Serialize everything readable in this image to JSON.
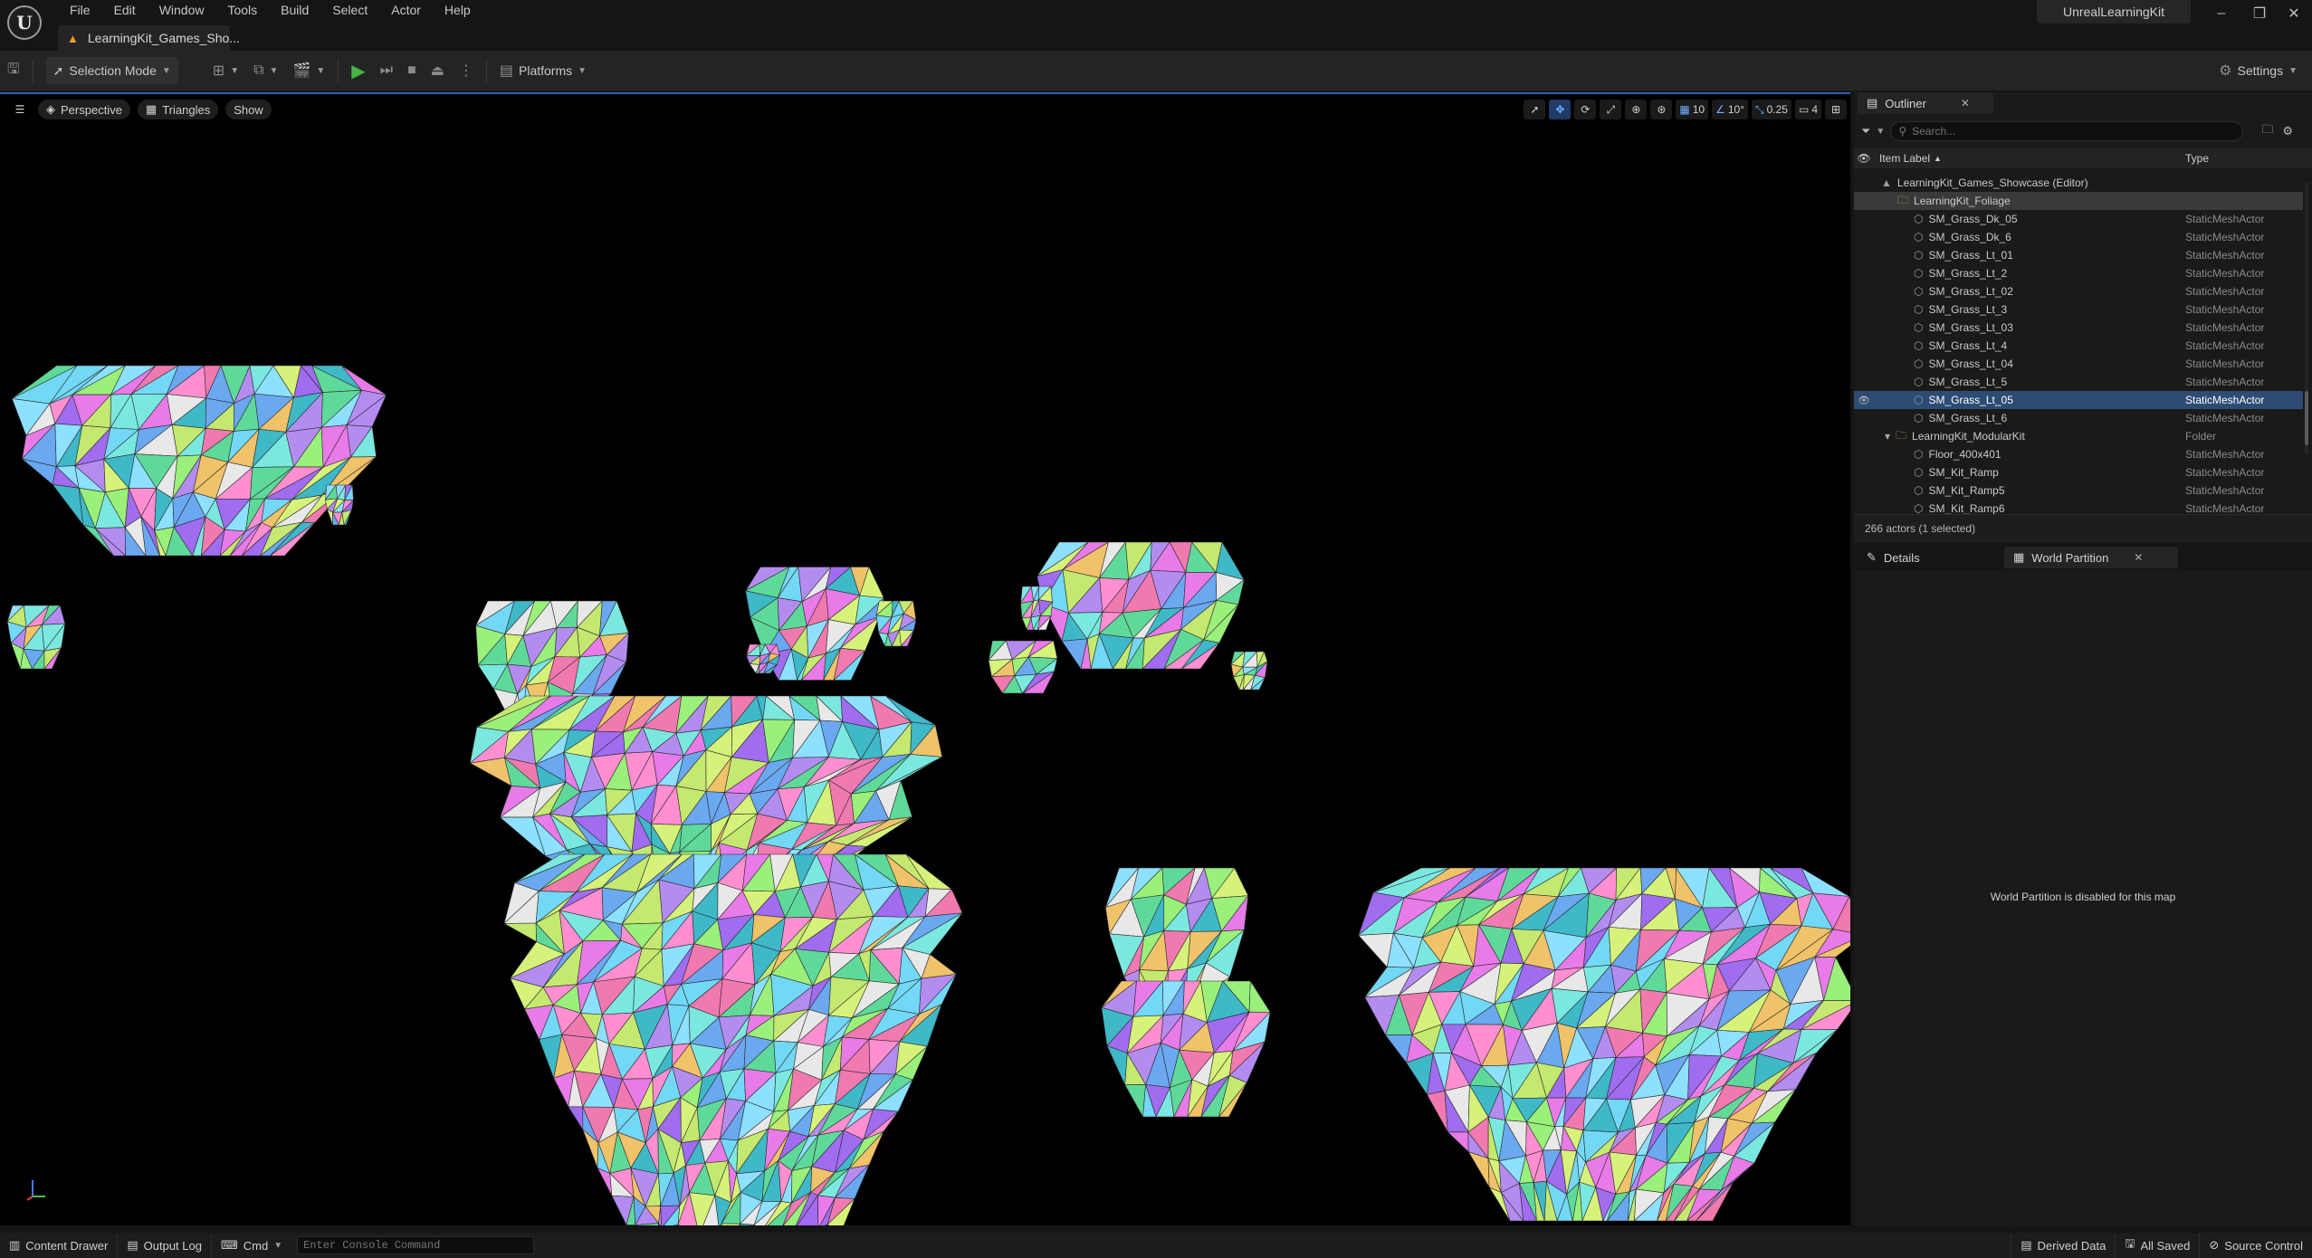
{
  "menu": [
    "File",
    "Edit",
    "Window",
    "Tools",
    "Build",
    "Select",
    "Actor",
    "Help"
  ],
  "project_name": "UnrealLearningKit",
  "document_tab": "LearningKit_Games_Sho...",
  "toolbar": {
    "mode_label": "Selection Mode",
    "platforms_label": "Platforms",
    "settings_label": "Settings"
  },
  "viewport": {
    "perspective_label": "Perspective",
    "view_mode_label": "Triangles",
    "show_label": "Show",
    "grid_snap": "10",
    "rotation_snap": "10°",
    "scale_snap": "0.25",
    "camera_speed": "4"
  },
  "outliner": {
    "tab_label": "Outliner",
    "search_placeholder": "Search...",
    "col_label": "Item Label",
    "col_type": "Type",
    "rows": [
      {
        "label": "LearningKit_Games_Showcase (Editor)",
        "type": "",
        "kind": "world",
        "indent": 0
      },
      {
        "label": "LearningKit_Foliage",
        "type": "",
        "kind": "folder",
        "indent": 1
      },
      {
        "label": "SM_Grass_Dk_05",
        "type": "StaticMeshActor",
        "kind": "mesh",
        "indent": 2
      },
      {
        "label": "SM_Grass_Dk_6",
        "type": "StaticMeshActor",
        "kind": "mesh",
        "indent": 2
      },
      {
        "label": "SM_Grass_Lt_01",
        "type": "StaticMeshActor",
        "kind": "mesh",
        "indent": 2
      },
      {
        "label": "SM_Grass_Lt_2",
        "type": "StaticMeshActor",
        "kind": "mesh",
        "indent": 2
      },
      {
        "label": "SM_Grass_Lt_02",
        "type": "StaticMeshActor",
        "kind": "mesh",
        "indent": 2
      },
      {
        "label": "SM_Grass_Lt_3",
        "type": "StaticMeshActor",
        "kind": "mesh",
        "indent": 2
      },
      {
        "label": "SM_Grass_Lt_03",
        "type": "StaticMeshActor",
        "kind": "mesh",
        "indent": 2
      },
      {
        "label": "SM_Grass_Lt_4",
        "type": "StaticMeshActor",
        "kind": "mesh",
        "indent": 2
      },
      {
        "label": "SM_Grass_Lt_04",
        "type": "StaticMeshActor",
        "kind": "mesh",
        "indent": 2
      },
      {
        "label": "SM_Grass_Lt_5",
        "type": "StaticMeshActor",
        "kind": "mesh",
        "indent": 2
      },
      {
        "label": "SM_Grass_Lt_05",
        "type": "StaticMeshActor",
        "kind": "mesh",
        "indent": 2,
        "selected": true
      },
      {
        "label": "SM_Grass_Lt_6",
        "type": "StaticMeshActor",
        "kind": "mesh",
        "indent": 2
      },
      {
        "label": "LearningKit_ModularKit",
        "type": "Folder",
        "kind": "folder",
        "indent": 1
      },
      {
        "label": "Floor_400x401",
        "type": "StaticMeshActor",
        "kind": "mesh",
        "indent": 2
      },
      {
        "label": "SM_Kit_Ramp",
        "type": "StaticMeshActor",
        "kind": "mesh",
        "indent": 2
      },
      {
        "label": "SM_Kit_Ramp5",
        "type": "StaticMeshActor",
        "kind": "mesh",
        "indent": 2
      },
      {
        "label": "SM_Kit_Ramp6",
        "type": "StaticMeshActor",
        "kind": "mesh",
        "indent": 2
      }
    ],
    "status": "266 actors (1 selected)"
  },
  "details": {
    "details_tab": "Details",
    "world_partition_tab": "World Partition",
    "message": "World Partition is disabled for this map"
  },
  "statusbar": {
    "content_drawer": "Content Drawer",
    "output_log": "Output Log",
    "cmd": "Cmd",
    "console_placeholder": "Enter Console Command",
    "derived_data": "Derived Data",
    "all_saved": "All Saved",
    "source_control": "Source Control"
  }
}
